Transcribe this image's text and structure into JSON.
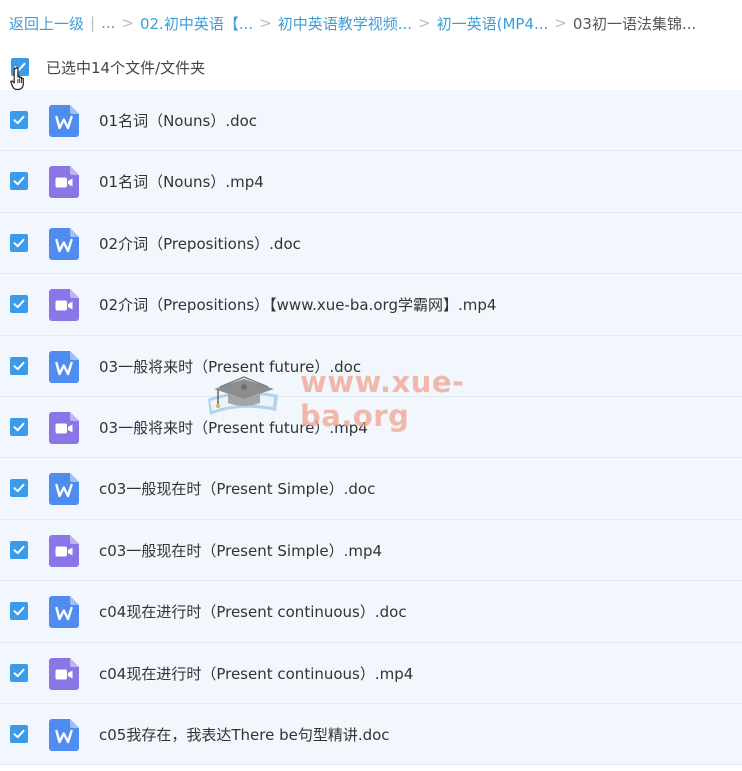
{
  "breadcrumb": {
    "back": "返回上一级",
    "divider": "|",
    "ellipsis": "...",
    "items": [
      "02.初中英语【...",
      "初中英语教学视频...",
      "初一英语(MP4..."
    ],
    "current": "03初一语法集锦..."
  },
  "selection": {
    "label": "已选中14个文件/文件夹"
  },
  "colors": {
    "link": "#3b9ed8",
    "checkbox": "#3a9bea",
    "doc_icon": "#4f8cf0",
    "video_icon": "#8b76e8",
    "row_bg": "#f1f7fd"
  },
  "files": [
    {
      "name": "01名词（Nouns）.doc",
      "type": "doc",
      "icon": "word-doc-icon"
    },
    {
      "name": "01名词（Nouns）.mp4",
      "type": "video",
      "icon": "video-file-icon"
    },
    {
      "name": "02介词（Prepositions）.doc",
      "type": "doc",
      "icon": "word-doc-icon"
    },
    {
      "name": "02介词（Prepositions）【www.xue-ba.org学霸网】.mp4",
      "type": "video",
      "icon": "video-file-icon"
    },
    {
      "name": "03一般将来时（Present future）.doc",
      "type": "doc",
      "icon": "word-doc-icon"
    },
    {
      "name": "03一般将来时（Present future）.mp4",
      "type": "video",
      "icon": "video-file-icon"
    },
    {
      "name": "c03一般现在时（Present Simple）.doc",
      "type": "doc",
      "icon": "word-doc-icon"
    },
    {
      "name": "c03一般现在时（Present Simple）.mp4",
      "type": "video",
      "icon": "video-file-icon"
    },
    {
      "name": "c04现在进行时（Present continuous）.doc",
      "type": "doc",
      "icon": "word-doc-icon"
    },
    {
      "name": "c04现在进行时（Present continuous）.mp4",
      "type": "video",
      "icon": "video-file-icon"
    },
    {
      "name": "c05我存在，我表达There be句型精讲.doc",
      "type": "doc",
      "icon": "word-doc-icon"
    }
  ],
  "watermark": {
    "text": "www.xue-ba.org"
  }
}
